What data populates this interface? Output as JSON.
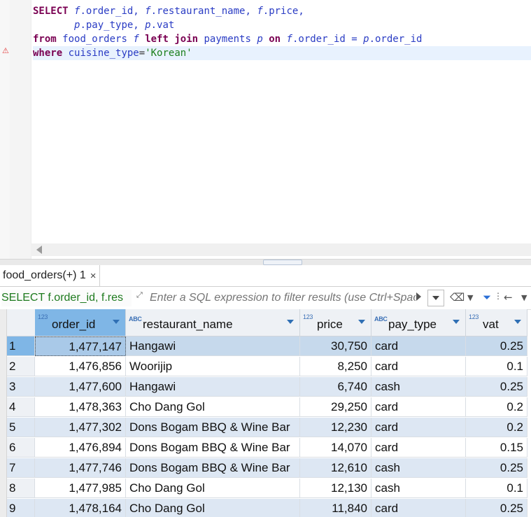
{
  "editor": {
    "line1": {
      "kw": "SELECT",
      "parts": [
        "f",
        ".order_id, ",
        "f",
        ".restaurant_name, ",
        "f",
        ".price,"
      ]
    },
    "line2": {
      "parts": [
        "p",
        ".pay_type, ",
        "p",
        ".vat"
      ]
    },
    "line3": {
      "kw1": "from",
      "table": "food_orders",
      "alias": "f",
      "kw2": "left join",
      "table2": "payments",
      "alias2": "p",
      "kw3": "on",
      "cond": [
        "f",
        ".order_id = ",
        "p",
        ".order_id"
      ]
    },
    "line4": {
      "kw": "where",
      "col": "cuisine_type",
      "op": "=",
      "val": "'Korean'"
    }
  },
  "results_tab": {
    "label": "food_orders(+) 1",
    "close": "×"
  },
  "filter": {
    "sql_preview": "SELECT f.order_id, f.res",
    "placeholder": "Enter a SQL expression to filter results (use Ctrl+Space)"
  },
  "columns": [
    {
      "type": "123",
      "name": "order_id"
    },
    {
      "type": "ABC",
      "name": "restaurant_name"
    },
    {
      "type": "123",
      "name": "price"
    },
    {
      "type": "ABC",
      "name": "pay_type"
    },
    {
      "type": "123",
      "name": "vat"
    }
  ],
  "rows": [
    {
      "n": "1",
      "order_id": "1,477,147",
      "restaurant_name": "Hangawi",
      "price": "30,750",
      "pay_type": "card",
      "vat": "0.25"
    },
    {
      "n": "2",
      "order_id": "1,476,856",
      "restaurant_name": "Woorijip",
      "price": "8,250",
      "pay_type": "card",
      "vat": "0.1"
    },
    {
      "n": "3",
      "order_id": "1,477,600",
      "restaurant_name": "Hangawi",
      "price": "6,740",
      "pay_type": "cash",
      "vat": "0.25"
    },
    {
      "n": "4",
      "order_id": "1,478,363",
      "restaurant_name": "Cho Dang Gol",
      "price": "29,250",
      "pay_type": "card",
      "vat": "0.2"
    },
    {
      "n": "5",
      "order_id": "1,477,302",
      "restaurant_name": "Dons Bogam BBQ & Wine Bar",
      "price": "12,230",
      "pay_type": "card",
      "vat": "0.2"
    },
    {
      "n": "6",
      "order_id": "1,476,894",
      "restaurant_name": "Dons Bogam BBQ & Wine Bar",
      "price": "14,070",
      "pay_type": "card",
      "vat": "0.15"
    },
    {
      "n": "7",
      "order_id": "1,477,746",
      "restaurant_name": "Dons Bogam BBQ & Wine Bar",
      "price": "12,610",
      "pay_type": "cash",
      "vat": "0.25"
    },
    {
      "n": "8",
      "order_id": "1,477,985",
      "restaurant_name": "Cho Dang Gol",
      "price": "12,130",
      "pay_type": "cash",
      "vat": "0.1"
    },
    {
      "n": "9",
      "order_id": "1,478,164",
      "restaurant_name": "Cho Dang Gol",
      "price": "11,840",
      "pay_type": "card",
      "vat": "0.25"
    }
  ]
}
